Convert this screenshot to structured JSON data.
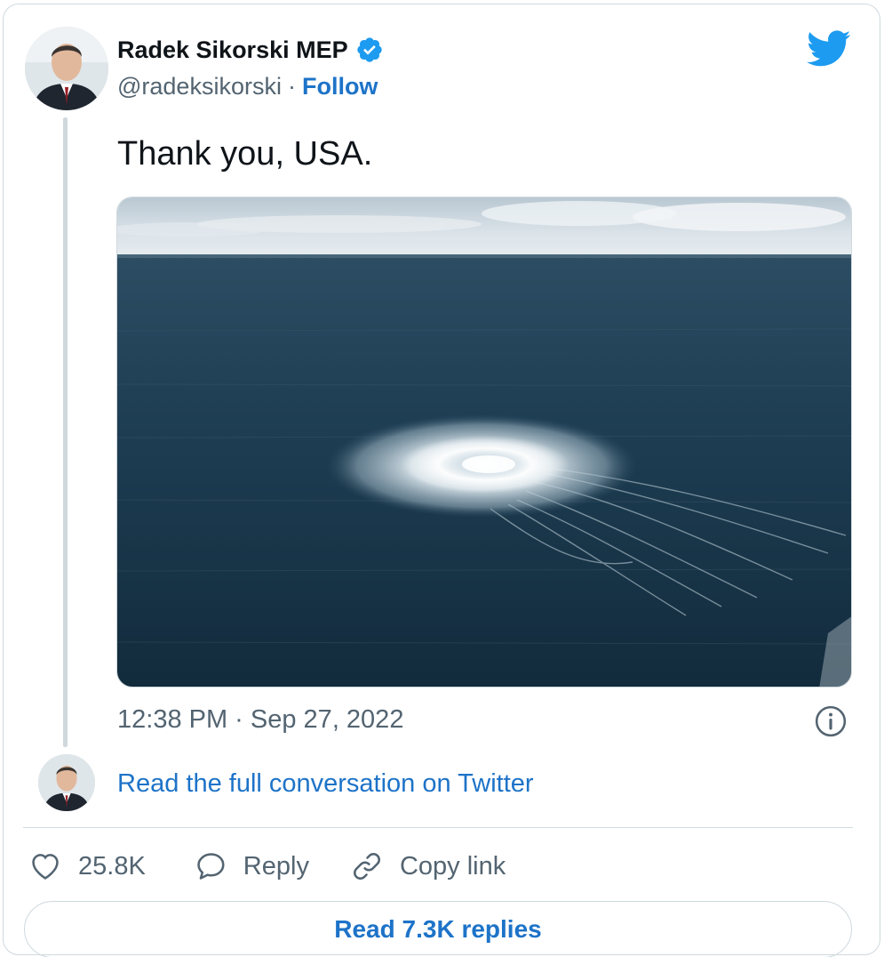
{
  "author": {
    "name": "Radek Sikorski MEP",
    "handle": "@radeksikorski",
    "separator": "·",
    "follow_label": "Follow"
  },
  "tweet": {
    "text": "Thank you, USA.",
    "timestamp": "12:38 PM · Sep 27, 2022"
  },
  "conversation": {
    "read_full_label": "Read the full conversation on Twitter"
  },
  "actions": {
    "likes": "25.8K",
    "reply_label": "Reply",
    "copy_link_label": "Copy link"
  },
  "replies_button": {
    "label": "Read 7.3K replies"
  },
  "icons": {
    "verified": "verified-badge-icon",
    "logo": "twitter-bird-icon",
    "info": "info-circle-icon",
    "like": "heart-icon",
    "reply": "speech-bubble-icon",
    "copy": "link-icon"
  },
  "colors": {
    "accent_blue": "#1d73c8",
    "twitter_blue": "#1d9bf0",
    "muted_text": "#536471",
    "border": "#cfd9de"
  }
}
